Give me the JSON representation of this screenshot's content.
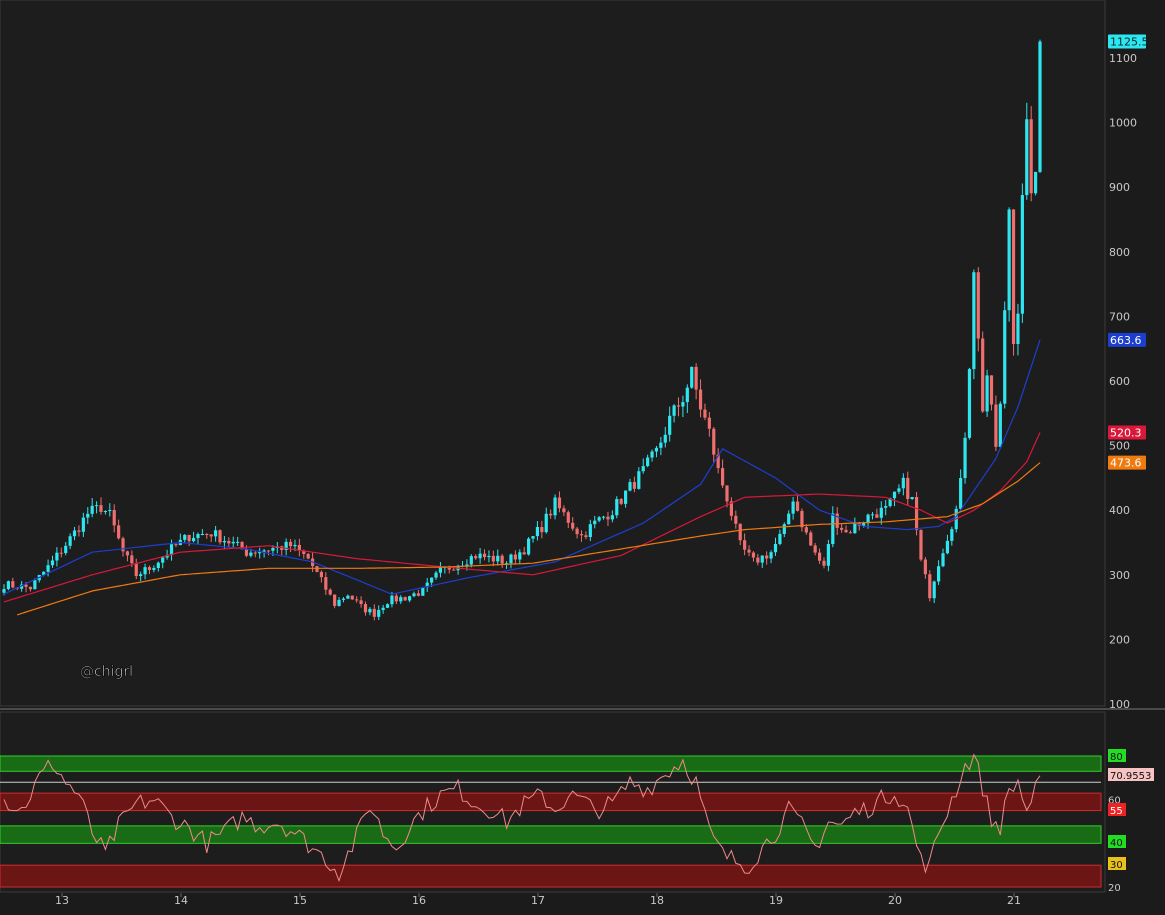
{
  "watermark": "@chigrl",
  "colors": {
    "background": "#1b1b1b",
    "axis_text": "#c8c8c8",
    "candle_up": "#2ee6ef",
    "candle_down": "#ef6e6e",
    "ma_blue": "#1d3fcf",
    "ma_red": "#d9183a",
    "ma_orange": "#ee7a10",
    "rsi_line": "#f08a8a",
    "zone_green": "#1a6b16",
    "zone_red": "#6b1515"
  },
  "chart_data": [
    {
      "type": "candlestick",
      "x_ticks": [
        "13",
        "14",
        "15",
        "16",
        "17",
        "18",
        "19",
        "20",
        "21"
      ],
      "ylim": [
        100,
        1150
      ],
      "y_ticks": [
        100,
        200,
        300,
        400,
        500,
        600,
        700,
        800,
        900,
        1000,
        1100
      ],
      "price_anchors": [
        [
          0,
          285
        ],
        [
          6,
          280
        ],
        [
          11,
          320
        ],
        [
          16,
          365
        ],
        [
          19,
          395
        ],
        [
          22,
          405
        ],
        [
          24,
          392
        ],
        [
          27,
          335
        ],
        [
          30,
          300
        ],
        [
          33,
          310
        ],
        [
          38,
          340
        ],
        [
          42,
          360
        ],
        [
          47,
          365
        ],
        [
          52,
          348
        ],
        [
          55,
          335
        ],
        [
          60,
          340
        ],
        [
          65,
          345
        ],
        [
          69,
          325
        ],
        [
          72,
          290
        ],
        [
          75,
          255
        ],
        [
          78,
          270
        ],
        [
          81,
          250
        ],
        [
          84,
          240
        ],
        [
          87,
          260
        ],
        [
          91,
          265
        ],
        [
          95,
          275
        ],
        [
          99,
          305
        ],
        [
          103,
          318
        ],
        [
          107,
          330
        ],
        [
          111,
          325
        ],
        [
          114,
          320
        ],
        [
          118,
          340
        ],
        [
          122,
          375
        ],
        [
          125,
          410
        ],
        [
          128,
          385
        ],
        [
          131,
          360
        ],
        [
          134,
          380
        ],
        [
          138,
          400
        ],
        [
          142,
          435
        ],
        [
          145,
          460
        ],
        [
          148,
          490
        ],
        [
          151,
          540
        ],
        [
          154,
          575
        ],
        [
          156,
          610
        ],
        [
          158,
          560
        ],
        [
          160,
          520
        ],
        [
          162,
          460
        ],
        [
          164,
          420
        ],
        [
          167,
          345
        ],
        [
          170,
          320
        ],
        [
          174,
          335
        ],
        [
          177,
          370
        ],
        [
          179,
          420
        ],
        [
          181,
          380
        ],
        [
          183,
          345
        ],
        [
          186,
          310
        ],
        [
          188,
          390
        ],
        [
          191,
          365
        ],
        [
          194,
          380
        ],
        [
          197,
          395
        ],
        [
          200,
          400
        ],
        [
          202,
          420
        ],
        [
          204,
          440
        ],
        [
          206,
          415
        ],
        [
          208,
          320
        ],
        [
          210,
          270
        ],
        [
          212,
          320
        ],
        [
          214,
          360
        ],
        [
          216,
          400
        ],
        [
          217,
          440
        ],
        [
          218,
          520
        ],
        [
          219,
          630
        ],
        [
          220,
          780
        ],
        [
          221,
          660
        ],
        [
          222,
          560
        ],
        [
          223,
          610
        ],
        [
          224,
          550
        ],
        [
          225,
          500
        ],
        [
          226,
          560
        ],
        [
          227,
          700
        ],
        [
          228,
          870
        ],
        [
          229,
          660
        ],
        [
          230,
          720
        ],
        [
          231,
          900
        ],
        [
          232,
          990
        ],
        [
          233,
          870
        ],
        [
          234,
          940
        ],
        [
          235,
          1125.5
        ]
      ],
      "series": [
        {
          "name": "MA blue",
          "anchors": [
            [
              0,
              270
            ],
            [
              20,
              335
            ],
            [
              40,
              350
            ],
            [
              55,
              340
            ],
            [
              70,
              320
            ],
            [
              88,
              270
            ],
            [
              105,
              295
            ],
            [
              125,
              320
            ],
            [
              145,
              380
            ],
            [
              158,
              440
            ],
            [
              163,
              495
            ],
            [
              175,
              450
            ],
            [
              185,
              400
            ],
            [
              195,
              375
            ],
            [
              205,
              370
            ],
            [
              212,
              375
            ],
            [
              216,
              390
            ],
            [
              220,
              430
            ],
            [
              225,
              480
            ],
            [
              230,
              560
            ],
            [
              235,
              663.6
            ]
          ]
        },
        {
          "name": "MA red",
          "anchors": [
            [
              0,
              258
            ],
            [
              20,
              300
            ],
            [
              40,
              335
            ],
            [
              60,
              345
            ],
            [
              80,
              325
            ],
            [
              100,
              312
            ],
            [
              120,
              300
            ],
            [
              140,
              330
            ],
            [
              158,
              390
            ],
            [
              168,
              420
            ],
            [
              185,
              425
            ],
            [
              200,
              420
            ],
            [
              208,
              400
            ],
            [
              214,
              380
            ],
            [
              220,
              400
            ],
            [
              226,
              430
            ],
            [
              232,
              475
            ],
            [
              235,
              520.3
            ]
          ]
        },
        {
          "name": "MA orange",
          "anchors": [
            [
              3,
              238
            ],
            [
              20,
              275
            ],
            [
              40,
              300
            ],
            [
              60,
              310
            ],
            [
              80,
              310
            ],
            [
              100,
              312
            ],
            [
              120,
              318
            ],
            [
              140,
              340
            ],
            [
              158,
              360
            ],
            [
              168,
              370
            ],
            [
              185,
              378
            ],
            [
              200,
              382
            ],
            [
              214,
              390
            ],
            [
              222,
              410
            ],
            [
              230,
              445
            ],
            [
              235,
              473.6
            ]
          ]
        }
      ],
      "labels": [
        {
          "text": "1125.5",
          "value": 1125.5,
          "color": "#2ee6ef"
        },
        {
          "text": "663.6",
          "value": 663.6,
          "color": "#1d3fcf"
        },
        {
          "text": "520.3",
          "value": 520.3,
          "color": "#d9183a"
        },
        {
          "text": "473.6",
          "value": 473.6,
          "color": "#ee7a10"
        }
      ]
    },
    {
      "type": "line",
      "ylim": [
        20,
        90
      ],
      "y_ticks": [
        20,
        60
      ],
      "zones": [
        {
          "from": 73,
          "to": 80,
          "color": "green"
        },
        {
          "from": 55,
          "to": 63,
          "color": "red"
        },
        {
          "from": 40,
          "to": 48,
          "color": "green"
        },
        {
          "from": 20,
          "to": 30,
          "color": "red"
        }
      ],
      "levels": [
        {
          "text": "80",
          "value": 80,
          "color": "#22dd22"
        },
        {
          "text": "70.9553",
          "value": 70.9553,
          "color": "#f6c2c2"
        },
        {
          "text": "55",
          "value": 55,
          "color": "#ee2222"
        },
        {
          "text": "40",
          "value": 40,
          "color": "#22dd22"
        },
        {
          "text": "30",
          "value": 30,
          "color": "#e8c21a"
        }
      ],
      "anchors": [
        [
          0,
          60
        ],
        [
          4,
          55
        ],
        [
          8,
          70
        ],
        [
          11,
          77
        ],
        [
          14,
          68
        ],
        [
          17,
          62
        ],
        [
          20,
          45
        ],
        [
          23,
          35
        ],
        [
          26,
          48
        ],
        [
          30,
          58
        ],
        [
          34,
          60
        ],
        [
          38,
          52
        ],
        [
          42,
          47
        ],
        [
          46,
          40
        ],
        [
          50,
          45
        ],
        [
          54,
          52
        ],
        [
          58,
          48
        ],
        [
          62,
          50
        ],
        [
          66,
          45
        ],
        [
          70,
          38
        ],
        [
          73,
          33
        ],
        [
          76,
          27
        ],
        [
          80,
          43
        ],
        [
          83,
          58
        ],
        [
          86,
          45
        ],
        [
          89,
          38
        ],
        [
          92,
          48
        ],
        [
          95,
          55
        ],
        [
          99,
          62
        ],
        [
          103,
          65
        ],
        [
          107,
          58
        ],
        [
          111,
          55
        ],
        [
          114,
          50
        ],
        [
          118,
          58
        ],
        [
          122,
          62
        ],
        [
          125,
          55
        ],
        [
          128,
          62
        ],
        [
          131,
          60
        ],
        [
          134,
          55
        ],
        [
          138,
          58
        ],
        [
          142,
          68
        ],
        [
          146,
          65
        ],
        [
          150,
          72
        ],
        [
          154,
          78
        ],
        [
          157,
          68
        ],
        [
          160,
          45
        ],
        [
          163,
          35
        ],
        [
          166,
          32
        ],
        [
          169,
          30
        ],
        [
          172,
          38
        ],
        [
          175,
          45
        ],
        [
          178,
          55
        ],
        [
          181,
          48
        ],
        [
          184,
          38
        ],
        [
          187,
          50
        ],
        [
          190,
          48
        ],
        [
          193,
          54
        ],
        [
          196,
          56
        ],
        [
          199,
          60
        ],
        [
          202,
          64
        ],
        [
          205,
          55
        ],
        [
          208,
          32
        ],
        [
          210,
          30
        ],
        [
          212,
          45
        ],
        [
          215,
          60
        ],
        [
          218,
          75
        ],
        [
          220,
          80
        ],
        [
          222,
          66
        ],
        [
          224,
          50
        ],
        [
          226,
          48
        ],
        [
          228,
          64
        ],
        [
          230,
          68
        ],
        [
          232,
          55
        ],
        [
          234,
          64
        ],
        [
          235,
          70.9553
        ]
      ]
    }
  ]
}
